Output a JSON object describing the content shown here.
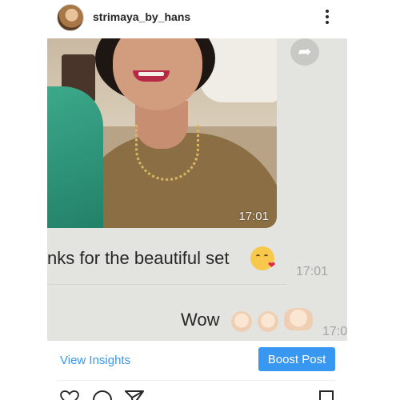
{
  "header": {
    "username": "strimaya_by_hans",
    "more_icon": "more-vertical-icon"
  },
  "media": {
    "photo_timestamp": "17:01",
    "forward_icon": "share-arrow-icon",
    "message_1": {
      "text": "nks for the beautiful set",
      "emoji": "kissing-face-emoji",
      "time": "17:01"
    },
    "message_2": {
      "text": "Wow",
      "emojis": [
        "ok-hand-emoji",
        "ok-hand-emoji",
        "raising-hands-emoji"
      ],
      "time": "17:0"
    }
  },
  "actions": {
    "insights_label": "View Insights",
    "boost_label": "Boost Post",
    "accent_color": "#3897f0"
  },
  "icons": {
    "like": "heart-outline-icon",
    "comment": "comment-icon",
    "share": "direct-send-icon",
    "save": "bookmark-icon"
  }
}
